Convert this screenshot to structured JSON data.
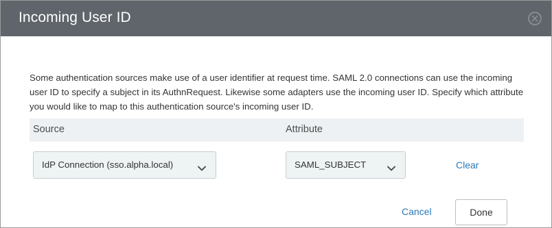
{
  "dialog": {
    "title": "Incoming User ID",
    "close_icon": "close-circle-icon",
    "description": "Some authentication sources make use of a user identifier at request time. SAML 2.0 connections can use the incoming user ID to specify a subject in its AuthnRequest. Likewise some adapters use the incoming user ID. Specify which attribute you would like to map to this authentication source's incoming user ID."
  },
  "table": {
    "columns": [
      "Source",
      "Attribute"
    ],
    "row": {
      "source_value": "IdP Connection (sso.alpha.local)",
      "attribute_value": "SAML_SUBJECT",
      "clear_label": "Clear"
    }
  },
  "footer": {
    "cancel_label": "Cancel",
    "done_label": "Done"
  },
  "colors": {
    "header_bg": "#5f656b",
    "link": "#2a7ab9",
    "select_bg": "#eef3f4",
    "table_header_bg": "#eef1f3"
  }
}
